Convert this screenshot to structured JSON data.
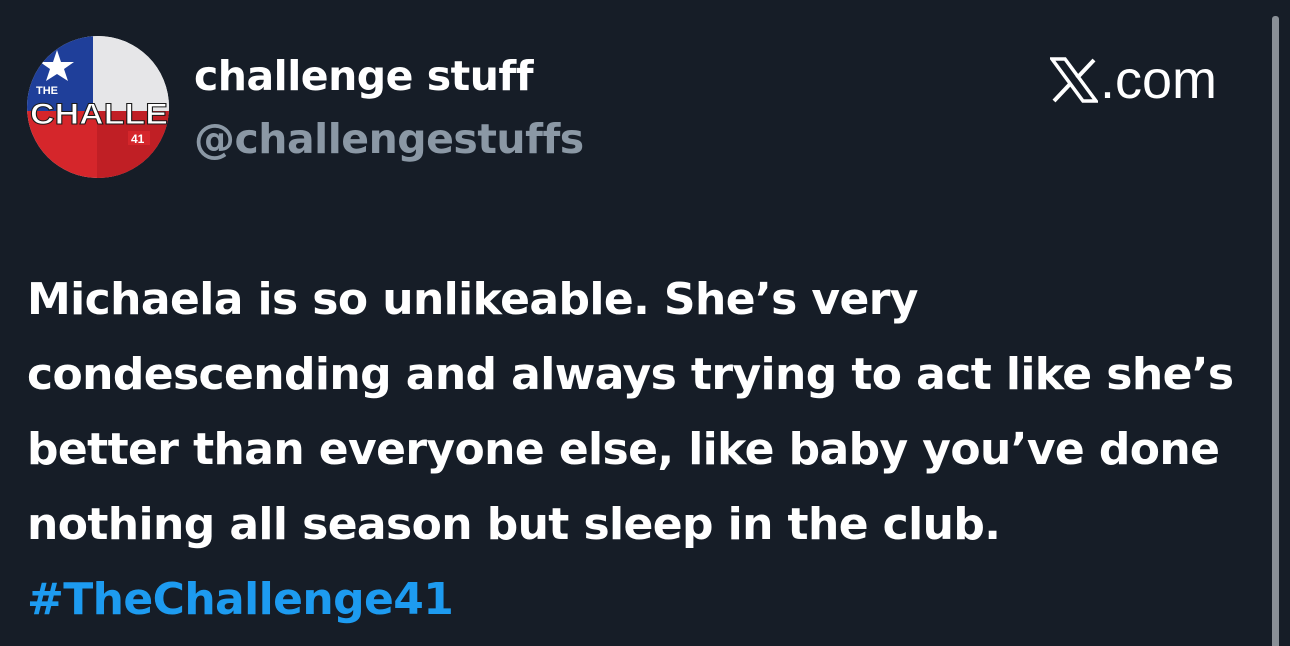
{
  "profile": {
    "display_name": "challenge stuff",
    "handle": "@challengestuffs",
    "avatar_text_top": "THE",
    "avatar_text_main": "CHALLE",
    "avatar_text_number": "41"
  },
  "brand": {
    "label": ".com",
    "icon": "x-logo-icon"
  },
  "tweet": {
    "text": "Michaela is so unlikeable. She’s very condescending and always trying to act like she’s better than everyone else, like baby you’ve done nothing all season but sleep in the club.",
    "hashtag": "#TheChallenge41"
  },
  "colors": {
    "background": "#161d27",
    "text": "#ffffff",
    "handle": "#8b98a5",
    "hashtag": "#1d9bf0",
    "flag_blue": "#1f3f9a",
    "flag_red": "#d5262b",
    "flag_white": "#f4f4f4"
  }
}
